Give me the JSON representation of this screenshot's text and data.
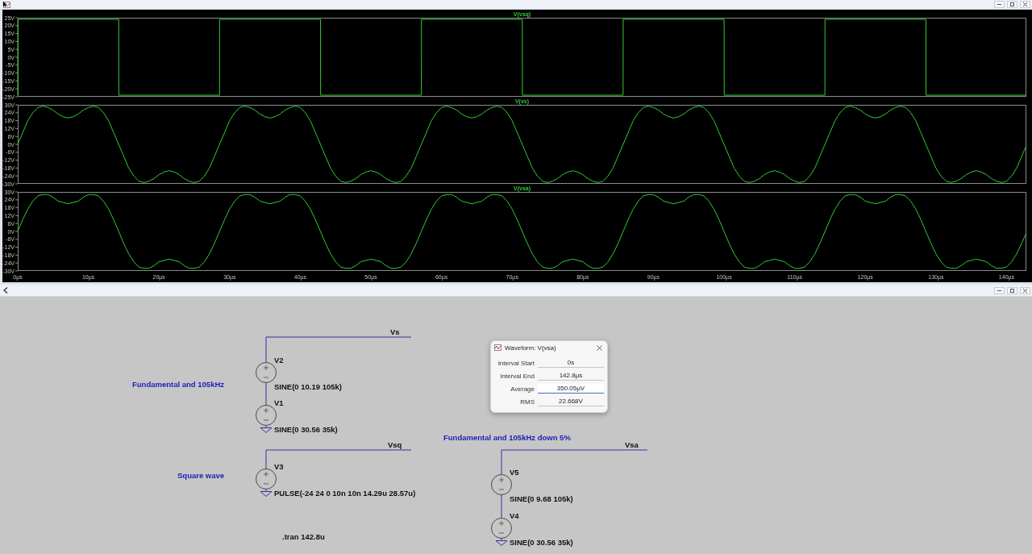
{
  "plot_window": {
    "panes": [
      {
        "chart_data": {
          "type": "line",
          "xlim": [
            0,
            142.8
          ],
          "ylim": [
            -25,
            25
          ],
          "yticks": [
            {
              "value": 25,
              "label": "25V"
            },
            {
              "value": 20,
              "label": "20V"
            },
            {
              "value": 15,
              "label": "15V"
            },
            {
              "value": 10,
              "label": "10V"
            },
            {
              "value": 5,
              "label": "5V"
            },
            {
              "value": 0,
              "label": "0V"
            },
            {
              "value": -5,
              "label": "-5V"
            },
            {
              "value": -10,
              "label": "-10V"
            },
            {
              "value": -15,
              "label": "-15V"
            },
            {
              "value": -20,
              "label": "-20V"
            },
            {
              "value": -25,
              "label": "-25V"
            }
          ],
          "x": [
            0,
            0.01,
            14.3,
            14.31,
            28.57,
            28.58,
            42.87,
            42.88,
            57.14,
            57.15,
            71.44,
            71.45,
            85.71,
            85.72,
            100.01,
            100.02,
            114.28,
            114.29,
            128.58,
            128.59,
            142.8
          ],
          "series": [
            {
              "name": "V(vsq)",
              "color": "#33cc33",
              "values": [
                -24,
                24,
                24,
                -24,
                -24,
                24,
                24,
                -24,
                -24,
                24,
                24,
                -24,
                -24,
                24,
                24,
                -24,
                -24,
                24,
                24,
                -24,
                -24
              ]
            }
          ]
        }
      },
      {
        "chart_data": {
          "type": "line",
          "xlim": [
            0,
            142.8
          ],
          "ylim": [
            -30,
            30
          ],
          "yticks": [
            {
              "value": 30,
              "label": "30V"
            },
            {
              "value": 24,
              "label": "24V"
            },
            {
              "value": 18,
              "label": "18V"
            },
            {
              "value": 12,
              "label": "12V"
            },
            {
              "value": 6,
              "label": "6V"
            },
            {
              "value": 0,
              "label": "0V"
            },
            {
              "value": -6,
              "label": "-6V"
            },
            {
              "value": -12,
              "label": "-12V"
            },
            {
              "value": -18,
              "label": "-18V"
            },
            {
              "value": -24,
              "label": "-24V"
            },
            {
              "value": -30,
              "label": "-30V"
            }
          ],
          "x": [
            0,
            0.71,
            1.43,
            2.14,
            2.86,
            3.57,
            4.29,
            5,
            5.71,
            6.43,
            7.14,
            7.86,
            8.57,
            9.29,
            10,
            10.71,
            11.43,
            12.14,
            12.86,
            13.57,
            14.29,
            15,
            15.71,
            16.43,
            17.14,
            17.86,
            18.57,
            19.29,
            20,
            20.71,
            21.43,
            22.14,
            22.86,
            23.57,
            24.29,
            25,
            25.71,
            26.43,
            27.14,
            27.86,
            28.57,
            29.29,
            30,
            30.71,
            31.43,
            32.14,
            32.86,
            33.57,
            34.29,
            35,
            35.71,
            36.43,
            37.14,
            37.86,
            38.57,
            39.29,
            40,
            40.71,
            41.43,
            42.14,
            42.86,
            43.57,
            44.29,
            45,
            45.71,
            46.43,
            47.14,
            47.86,
            48.57,
            49.29,
            50,
            50.71,
            51.43,
            52.14,
            52.86,
            53.57,
            54.29,
            55,
            55.71,
            56.43,
            57.14,
            57.86,
            58.57,
            59.29,
            60,
            60.71,
            61.43,
            62.14,
            62.86,
            63.57,
            64.29,
            65,
            65.71,
            66.43,
            67.14,
            67.86,
            68.57,
            69.29,
            70,
            70.71,
            71.43,
            72.14,
            72.86,
            73.57,
            74.29,
            75,
            75.71,
            76.43,
            77.14,
            77.86,
            78.57,
            79.29,
            80,
            80.71,
            81.43,
            82.14,
            82.86,
            83.57,
            84.29,
            85,
            85.71,
            86.43,
            87.14,
            87.86,
            88.57,
            89.29,
            90,
            90.71,
            91.43,
            92.14,
            92.86,
            93.57,
            94.29,
            95,
            95.71,
            96.43,
            97.14,
            97.86,
            98.57,
            99.29,
            100,
            100.71,
            101.43,
            102.14,
            102.86,
            103.57,
            104.29,
            105,
            105.71,
            106.43,
            107.14,
            107.86,
            108.57,
            109.29,
            110,
            110.71,
            111.43,
            112.14,
            112.86,
            113.57,
            114.29,
            115,
            115.71,
            116.43,
            117.14,
            117.86,
            118.57,
            119.29,
            120,
            120.71,
            121.43,
            122.14,
            122.86,
            123.57,
            124.29,
            125,
            125.71,
            126.43,
            127.14,
            127.86,
            128.57,
            129.29,
            130,
            130.71,
            131.43,
            132.14,
            132.86,
            133.57,
            134.29,
            135,
            135.71,
            136.43,
            137.14,
            137.86,
            138.57,
            139.29,
            140,
            140.71,
            141.43,
            142.14,
            142.8
          ],
          "series": [
            {
              "name": "V(vs)",
              "color": "#33cc33",
              "values": [
                0,
                9,
                18,
                24,
                28,
                29,
                28,
                26,
                23,
                21,
                20,
                21,
                23,
                26,
                28,
                29,
                28,
                24,
                18,
                9,
                0,
                -9,
                -18,
                -24,
                -28,
                -29,
                -28,
                -26,
                -23,
                -21,
                -20,
                -21,
                -23,
                -26,
                -28,
                -29,
                -28,
                -24,
                -18,
                -9,
                0,
                9,
                18,
                24,
                28,
                29,
                28,
                26,
                23,
                21,
                20,
                21,
                23,
                26,
                28,
                29,
                28,
                24,
                18,
                9,
                0,
                -9,
                -18,
                -24,
                -28,
                -29,
                -28,
                -26,
                -23,
                -21,
                -20,
                -21,
                -23,
                -26,
                -28,
                -29,
                -28,
                -24,
                -18,
                -9,
                0,
                9,
                18,
                24,
                28,
                29,
                28,
                26,
                23,
                21,
                20,
                21,
                23,
                26,
                28,
                29,
                28,
                24,
                18,
                9,
                0,
                -9,
                -18,
                -24,
                -28,
                -29,
                -28,
                -26,
                -23,
                -21,
                -20,
                -21,
                -23,
                -26,
                -28,
                -29,
                -28,
                -24,
                -18,
                -9,
                0,
                9,
                18,
                24,
                28,
                29,
                28,
                26,
                23,
                21,
                20,
                21,
                23,
                26,
                28,
                29,
                28,
                24,
                18,
                9,
                0,
                -9,
                -18,
                -24,
                -28,
                -29,
                -28,
                -26,
                -23,
                -21,
                -20,
                -21,
                -23,
                -26,
                -28,
                -29,
                -28,
                -24,
                -18,
                -9,
                0,
                9,
                18,
                24,
                28,
                29,
                28,
                26,
                23,
                21,
                20,
                21,
                23,
                26,
                28,
                29,
                28,
                24,
                18,
                9,
                0,
                -9,
                -18,
                -24,
                -28,
                -29,
                -28,
                -26,
                -23,
                -21,
                -20,
                -21,
                -23,
                -26,
                -28,
                -29,
                -28,
                -24,
                -18,
                -9,
                -1
              ]
            }
          ]
        }
      },
      {
        "chart_data": {
          "type": "line",
          "xlim": [
            0,
            142.8
          ],
          "ylim": [
            -30,
            30
          ],
          "xticks": [
            {
              "value": 0,
              "label": "0µs"
            },
            {
              "value": 10,
              "label": "10µs"
            },
            {
              "value": 20,
              "label": "20µs"
            },
            {
              "value": 30,
              "label": "30µs"
            },
            {
              "value": 40,
              "label": "40µs"
            },
            {
              "value": 50,
              "label": "50µs"
            },
            {
              "value": 60,
              "label": "60µs"
            },
            {
              "value": 70,
              "label": "70µs"
            },
            {
              "value": 80,
              "label": "80µs"
            },
            {
              "value": 90,
              "label": "90µs"
            },
            {
              "value": 100,
              "label": "100µs"
            },
            {
              "value": 110,
              "label": "110µs"
            },
            {
              "value": 120,
              "label": "120µs"
            },
            {
              "value": 130,
              "label": "130µs"
            },
            {
              "value": 140,
              "label": "140µs"
            }
          ],
          "yticks": [
            {
              "value": 30,
              "label": "30V"
            },
            {
              "value": 24,
              "label": "24V"
            },
            {
              "value": 18,
              "label": "18V"
            },
            {
              "value": 12,
              "label": "12V"
            },
            {
              "value": 6,
              "label": "6V"
            },
            {
              "value": 0,
              "label": "0V"
            },
            {
              "value": -6,
              "label": "-6V"
            },
            {
              "value": -12,
              "label": "-12V"
            },
            {
              "value": -18,
              "label": "-18V"
            },
            {
              "value": -24,
              "label": "-24V"
            },
            {
              "value": -30,
              "label": "-30V"
            }
          ],
          "x": [
            0,
            0.71,
            1.43,
            2.14,
            2.86,
            3.57,
            4.29,
            5,
            5.71,
            6.43,
            7.14,
            7.86,
            8.57,
            9.29,
            10,
            10.71,
            11.43,
            12.14,
            12.86,
            13.57,
            14.29,
            15,
            15.71,
            16.43,
            17.14,
            17.86,
            18.57,
            19.29,
            20,
            20.71,
            21.43,
            22.14,
            22.86,
            23.57,
            24.29,
            25,
            25.71,
            26.43,
            27.14,
            27.86,
            28.57,
            29.29,
            30,
            30.71,
            31.43,
            32.14,
            32.86,
            33.57,
            34.29,
            35,
            35.71,
            36.43,
            37.14,
            37.86,
            38.57,
            39.29,
            40,
            40.71,
            41.43,
            42.14,
            42.86,
            43.57,
            44.29,
            45,
            45.71,
            46.43,
            47.14,
            47.86,
            48.57,
            49.29,
            50,
            50.71,
            51.43,
            52.14,
            52.86,
            53.57,
            54.29,
            55,
            55.71,
            56.43,
            57.14,
            57.86,
            58.57,
            59.29,
            60,
            60.71,
            61.43,
            62.14,
            62.86,
            63.57,
            64.29,
            65,
            65.71,
            66.43,
            67.14,
            67.86,
            68.57,
            69.29,
            70,
            70.71,
            71.43,
            72.14,
            72.86,
            73.57,
            74.29,
            75,
            75.71,
            76.43,
            77.14,
            77.86,
            78.57,
            79.29,
            80,
            80.71,
            81.43,
            82.14,
            82.86,
            83.57,
            84.29,
            85,
            85.71,
            86.43,
            87.14,
            87.86,
            88.57,
            89.29,
            90,
            90.71,
            91.43,
            92.14,
            92.86,
            93.57,
            94.29,
            95,
            95.71,
            96.43,
            97.14,
            97.86,
            98.57,
            99.29,
            100,
            100.71,
            101.43,
            102.14,
            102.86,
            103.57,
            104.29,
            105,
            105.71,
            106.43,
            107.14,
            107.86,
            108.57,
            109.29,
            110,
            110.71,
            111.43,
            112.14,
            112.86,
            113.57,
            114.29,
            115,
            115.71,
            116.43,
            117.14,
            117.86,
            118.57,
            119.29,
            120,
            120.71,
            121.43,
            122.14,
            122.86,
            123.57,
            124.29,
            125,
            125.71,
            126.43,
            127.14,
            127.86,
            128.57,
            129.29,
            130,
            130.71,
            131.43,
            132.14,
            132.86,
            133.57,
            134.29,
            135,
            135.71,
            136.43,
            137.14,
            137.86,
            138.57,
            139.29,
            140,
            140.71,
            141.43,
            142.14,
            142.8
          ],
          "series": [
            {
              "name": "V(vsa)",
              "color": "#33cc33",
              "values": [
                0,
                9,
                17,
                23,
                27,
                28,
                28,
                26,
                23,
                22,
                21,
                22,
                23,
                26,
                28,
                28,
                27,
                23,
                17,
                9,
                0,
                -9,
                -17,
                -23,
                -27,
                -28,
                -28,
                -26,
                -23,
                -22,
                -21,
                -22,
                -23,
                -26,
                -28,
                -28,
                -27,
                -23,
                -17,
                -9,
                0,
                9,
                17,
                23,
                27,
                28,
                28,
                26,
                23,
                22,
                21,
                22,
                23,
                26,
                28,
                28,
                27,
                23,
                17,
                9,
                0,
                -9,
                -17,
                -23,
                -27,
                -28,
                -28,
                -26,
                -23,
                -22,
                -21,
                -22,
                -23,
                -26,
                -28,
                -28,
                -27,
                -23,
                -17,
                -9,
                0,
                9,
                17,
                23,
                27,
                28,
                28,
                26,
                23,
                22,
                21,
                22,
                23,
                26,
                28,
                28,
                27,
                23,
                17,
                9,
                0,
                -9,
                -17,
                -23,
                -27,
                -28,
                -28,
                -26,
                -23,
                -22,
                -21,
                -22,
                -23,
                -26,
                -28,
                -28,
                -27,
                -23,
                -17,
                -9,
                0,
                9,
                17,
                23,
                27,
                28,
                28,
                26,
                23,
                22,
                21,
                22,
                23,
                26,
                28,
                28,
                27,
                23,
                17,
                9,
                0,
                -9,
                -17,
                -23,
                -27,
                -28,
                -28,
                -26,
                -23,
                -22,
                -21,
                -22,
                -23,
                -26,
                -28,
                -28,
                -27,
                -23,
                -17,
                -9,
                0,
                9,
                17,
                23,
                27,
                28,
                28,
                26,
                23,
                22,
                21,
                22,
                23,
                26,
                28,
                28,
                27,
                23,
                17,
                9,
                0,
                -9,
                -17,
                -23,
                -27,
                -28,
                -28,
                -26,
                -23,
                -22,
                -21,
                -22,
                -23,
                -26,
                -28,
                -28,
                -27,
                -23,
                -17,
                -9,
                -1
              ]
            }
          ]
        }
      }
    ]
  },
  "schematic_window": {
    "circuits": [
      {
        "net_label": "Vs",
        "comment": "Fundamental and 105kHz",
        "sources": [
          {
            "name": "V2",
            "value": "SINE(0 10.19 105k)"
          },
          {
            "name": "V1",
            "value": "SINE(0 30.56 35k)"
          }
        ]
      },
      {
        "net_label": "Vsq",
        "comment": "Square wave",
        "sources": [
          {
            "name": "V3",
            "value": "PULSE(-24 24 0 10n 10n 14.29u 28.57u)"
          }
        ]
      },
      {
        "net_label": "Vsa",
        "comment": "Fundamental and 105kHz down 5%",
        "sources": [
          {
            "name": "V5",
            "value": "SINE(0 9.68 105k)"
          },
          {
            "name": "V4",
            "value": "SINE(0 30.56 35k)"
          }
        ]
      }
    ],
    "directive": ".tran 142.8u",
    "dialog": {
      "title": "Waveform: V(vsa)",
      "rows": [
        {
          "label": "Interval Start",
          "value": "0s",
          "focused": false
        },
        {
          "label": "Interval End",
          "value": "142.8µs",
          "focused": false
        },
        {
          "label": "Average",
          "value": "350.05µV",
          "focused": true
        },
        {
          "label": "RMS",
          "value": "22.668V",
          "focused": false
        }
      ]
    }
  }
}
